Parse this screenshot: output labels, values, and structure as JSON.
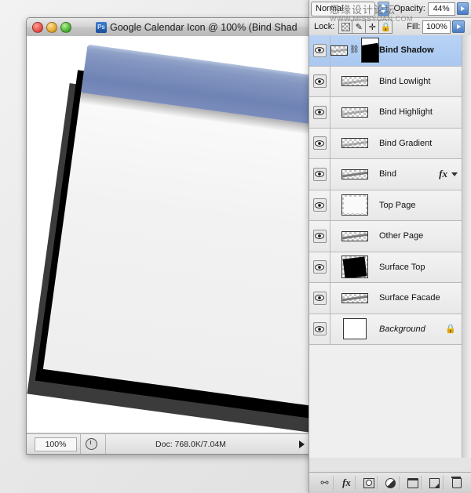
{
  "window": {
    "title": "Google Calendar Icon @ 100% (Bind Shad",
    "app_icon": "Ps",
    "traffic_lights": [
      "close-button",
      "minimize-button",
      "zoom-button"
    ]
  },
  "status_bar": {
    "zoom_value": "100%",
    "timing_icon": "clock-icon",
    "doc_info": "Doc: 768.0K/7.04M",
    "expand_arrow": "right-arrow-icon"
  },
  "panel": {
    "blend_mode": {
      "value": "Normal",
      "stepper_icon": "up-down-stepper-icon"
    },
    "opacity": {
      "label": "Opacity:",
      "value": "44%",
      "arrow_icon": "right-arrow-icon"
    },
    "lock": {
      "label": "Lock:",
      "buttons": [
        "lock-transparency-icon",
        "lock-pixels-icon",
        "lock-position-icon",
        "lock-all-icon"
      ]
    },
    "fill": {
      "label": "Fill:",
      "value": "100%",
      "arrow_icon": "right-arrow-icon"
    },
    "layers": [
      {
        "name": "Bind Shadow",
        "selected": true,
        "visible": true,
        "thumb": "checker-streak",
        "has_mask": true,
        "linked": true,
        "fx": false,
        "locked": false,
        "italic": false
      },
      {
        "name": "Bind Lowlight",
        "selected": false,
        "visible": true,
        "thumb": "checker-streak",
        "has_mask": false,
        "linked": false,
        "fx": false,
        "locked": false,
        "italic": false
      },
      {
        "name": "Bind Highlight",
        "selected": false,
        "visible": true,
        "thumb": "checker-streak",
        "has_mask": false,
        "linked": false,
        "fx": false,
        "locked": false,
        "italic": false
      },
      {
        "name": "Bind Gradient",
        "selected": false,
        "visible": true,
        "thumb": "checker-streak",
        "has_mask": false,
        "linked": false,
        "fx": false,
        "locked": false,
        "italic": false
      },
      {
        "name": "Bind",
        "selected": false,
        "visible": true,
        "thumb": "checker-bar",
        "has_mask": false,
        "linked": false,
        "fx": true,
        "locked": false,
        "italic": false
      },
      {
        "name": "Top Page",
        "selected": false,
        "visible": true,
        "thumb": "page-white",
        "has_mask": false,
        "linked": false,
        "fx": false,
        "locked": false,
        "italic": false
      },
      {
        "name": "Other Page",
        "selected": false,
        "visible": true,
        "thumb": "checker-bar",
        "has_mask": false,
        "linked": false,
        "fx": false,
        "locked": false,
        "italic": false
      },
      {
        "name": "Surface Top",
        "selected": false,
        "visible": true,
        "thumb": "black-square",
        "has_mask": false,
        "linked": false,
        "fx": false,
        "locked": false,
        "italic": false
      },
      {
        "name": "Surface Facade",
        "selected": false,
        "visible": true,
        "thumb": "checker-bar",
        "has_mask": false,
        "linked": false,
        "fx": false,
        "locked": false,
        "italic": false
      },
      {
        "name": "Background",
        "selected": false,
        "visible": true,
        "thumb": "solid-white",
        "has_mask": false,
        "linked": false,
        "fx": false,
        "locked": true,
        "italic": true
      }
    ],
    "bottom_toolbar": [
      "link-layers-icon",
      "layer-style-fx-icon",
      "layer-mask-icon",
      "adjustment-layer-icon",
      "new-group-icon",
      "new-layer-icon",
      "delete-layer-icon"
    ]
  },
  "watermark": {
    "chinese": "恩缘设计论坛",
    "english": "WWW.MISSYUAN.COM"
  },
  "colors": {
    "selection_blue": "#aecbf0",
    "bind_bar_blue": "#7a8cbb",
    "panel_grey": "#e4e4e4"
  }
}
